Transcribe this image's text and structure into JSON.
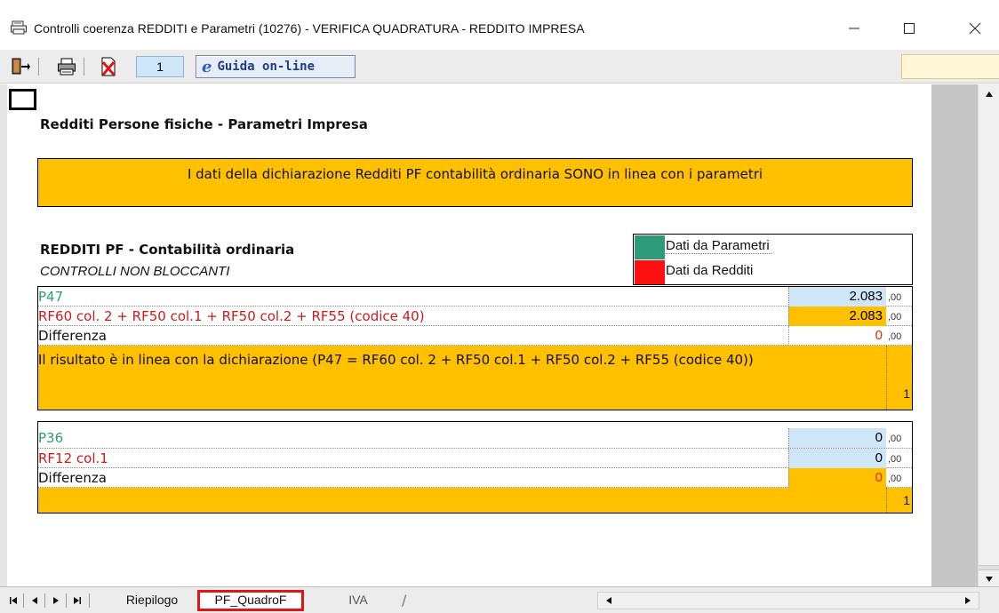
{
  "window": {
    "title": "Controlli coerenza REDDITI e Parametri (10276) - VERIFICA QUADRATURA - REDDITO IMPRESA",
    "minimize_glyph": "—",
    "maximize_glyph": "☐",
    "close_glyph": "✕"
  },
  "toolbar": {
    "page_number": "1",
    "help_label": "Guida on-line",
    "help_glyph": "e",
    "icons": [
      "exit-door-icon",
      "printer-icon",
      "delete-document-icon",
      "ie-help-icon"
    ]
  },
  "colors": {
    "accent_orange": "#ffc000",
    "value_blue": "#cfe6f9",
    "parametri_green": "#2f9a78",
    "redditi_red": "#e01616"
  },
  "content": {
    "section_title": "Redditi Persone fisiche - Parametri Impresa",
    "banner_text": "I dati della dichiarazione Redditi PF contabilità ordinaria SONO in linea con i parametri",
    "subsection_title": "REDDITI PF - Contabilità ordinaria",
    "subsection_note": "CONTROLLI NON BLOCCANTI",
    "legend": [
      {
        "label": "Dati da Parametri",
        "color": "#2f9a78"
      },
      {
        "label": "Dati da Redditi",
        "color": "#ff1010"
      }
    ],
    "block1": {
      "rows": [
        {
          "label": "P47",
          "value": "2.083",
          "cents": ",00"
        },
        {
          "label": "RF60 col. 2 + RF50 col.1 + RF50 col.2 +  RF55 (codice 40)",
          "value": "2.083",
          "cents": ",00"
        },
        {
          "label": "Differenza",
          "value": "0",
          "cents": ",00"
        }
      ],
      "result_text": "Il risultato è in linea con la dichiarazione (P47 = RF60 col. 2 + RF50 col.1 + RF50 col.2 + RF55 (codice 40))",
      "result_flag": "1"
    },
    "block2": {
      "rows": [
        {
          "label": "P36",
          "value": "0",
          "cents": ",00"
        },
        {
          "label": "RF12 col.1",
          "value": "0",
          "cents": ",00"
        },
        {
          "label": "Differenza",
          "value": "0",
          "cents": ",00"
        }
      ],
      "result_text": "",
      "result_flag": "1"
    }
  },
  "sheet_tabs": {
    "tabs": [
      "Riepilogo",
      "PF_QuadroF",
      "IVA"
    ],
    "active": "PF_QuadroF"
  }
}
